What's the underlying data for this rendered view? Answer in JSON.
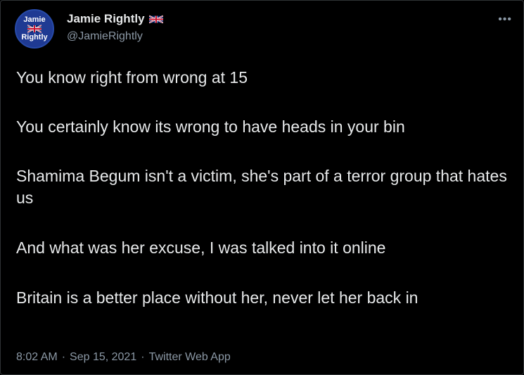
{
  "tweet": {
    "avatar": {
      "line1": "Jamie",
      "line2": "Rightly"
    },
    "display_name": "Jamie Rightly",
    "handle": "@JamieRightly",
    "more_label": "•••",
    "paragraphs": [
      "You know right from wrong at 15",
      "You certainly know its wrong to have heads in your bin",
      "Shamima Begum isn't a victim, she's part of a terror group that hates us",
      "And what was her excuse, I was talked into it online",
      "Britain is a better place without her, never let her back in"
    ],
    "time": "8:02 AM",
    "date": "Sep 15, 2021",
    "source": "Twitter Web App",
    "separator": "·"
  },
  "colors": {
    "background": "#000000",
    "text": "#e7e9ea",
    "secondary_text": "#8b98a5",
    "avatar_bg": "#1f3a93"
  },
  "icons": {
    "flag": "union-jack-flag-icon",
    "more": "more-options-icon"
  }
}
